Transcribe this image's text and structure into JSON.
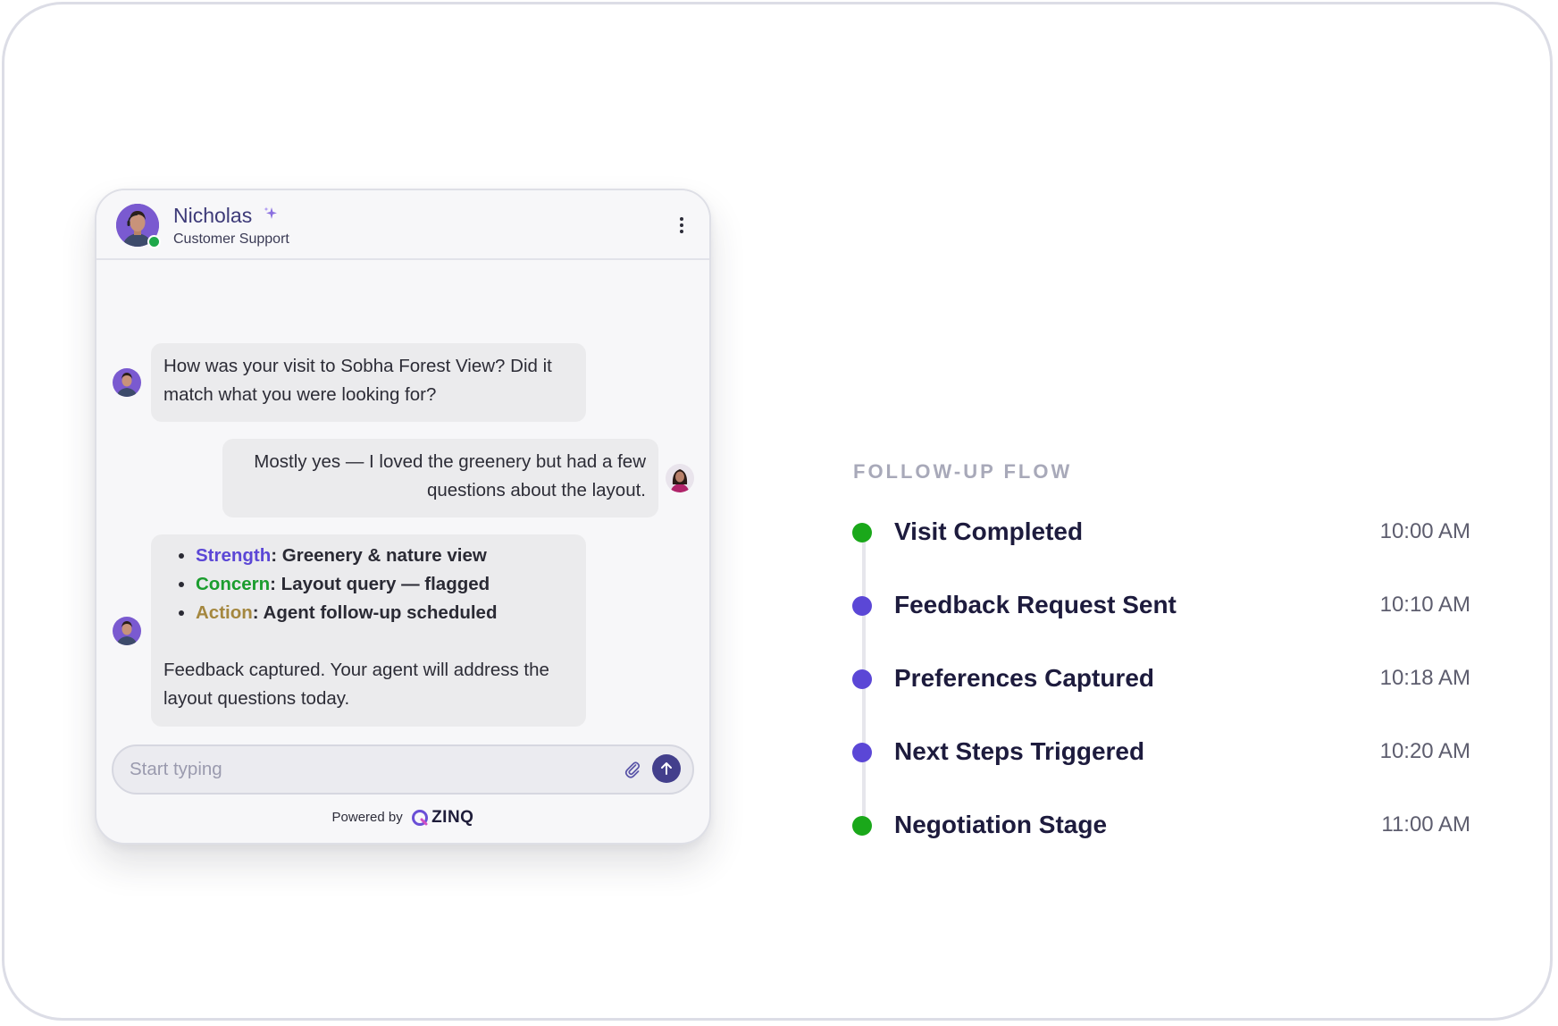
{
  "chat": {
    "agent_name": "Nicholas",
    "agent_role": "Customer Support",
    "messages": {
      "m1": "How was your visit to Sobha Forest View? Did it match what you were looking for?",
      "m2": "Mostly yes — I loved the greenery but had a few questions about the layout.",
      "m3": {
        "bullets": [
          {
            "key": "Strength",
            "value": ": Greenery & nature view"
          },
          {
            "key": "Concern",
            "value": ": Layout query — flagged"
          },
          {
            "key": "Action",
            "value": ": Agent follow-up scheduled"
          }
        ],
        "closing": "Feedback captured. Your agent will address the layout questions today."
      }
    },
    "input": {
      "placeholder": "Start typing",
      "value": ""
    },
    "footer": {
      "powered_by": "Powered by",
      "brand": "ZINQ"
    },
    "icons": {
      "sparkle": "sparkle-icon",
      "menu": "kebab-menu-icon",
      "attach": "paperclip-icon",
      "send": "arrow-up-icon"
    }
  },
  "flow": {
    "title": "FOLLOW-UP FLOW",
    "steps": [
      {
        "label": "Visit Completed",
        "time": "10:00 AM",
        "color": "#1aa81a"
      },
      {
        "label": "Feedback Request Sent",
        "time": "10:10 AM",
        "color": "#5b47d6"
      },
      {
        "label": "Preferences Captured",
        "time": "10:18 AM",
        "color": "#5b47d6"
      },
      {
        "label": "Next Steps Triggered",
        "time": "10:20 AM",
        "color": "#5b47d6"
      },
      {
        "label": "Negotiation Stage",
        "time": "11:00 AM",
        "color": "#1aa81a"
      }
    ]
  },
  "colors": {
    "accent": "#5b47d6",
    "success": "#1aa81a",
    "action": "#a4873f",
    "send_button": "#433f8c"
  }
}
